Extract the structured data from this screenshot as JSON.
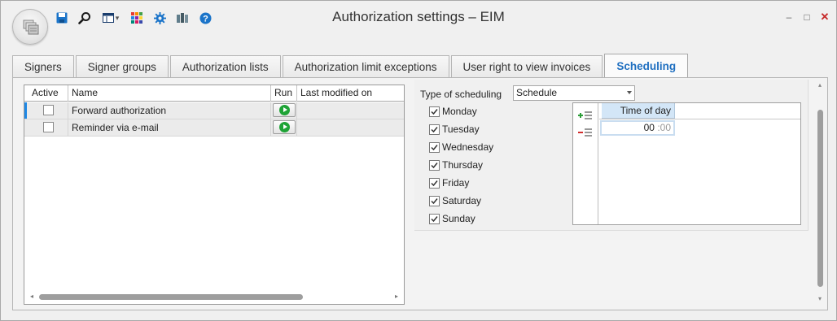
{
  "window": {
    "title": "Authorization settings – EIM",
    "controls": {
      "minimize": "–",
      "maximize": "□",
      "close": "✕"
    }
  },
  "toolbar": {
    "icons": [
      "save-icon",
      "search-icon",
      "layout-icon",
      "color-grid-icon",
      "gear-icon",
      "books-icon",
      "help-icon"
    ],
    "layout_dropdown": "▾"
  },
  "tabs": [
    {
      "label": "Signers",
      "active": false
    },
    {
      "label": "Signer groups",
      "active": false
    },
    {
      "label": "Authorization lists",
      "active": false
    },
    {
      "label": "Authorization limit exceptions",
      "active": false
    },
    {
      "label": "User right to view invoices",
      "active": false
    },
    {
      "label": "Scheduling",
      "active": true
    }
  ],
  "grid": {
    "columns": [
      "Active",
      "Name",
      "Run",
      "Last modified on"
    ],
    "rows": [
      {
        "active": false,
        "name": "Forward authorization",
        "last_modified": "",
        "selected": true
      },
      {
        "active": false,
        "name": "Reminder via e-mail",
        "last_modified": "",
        "selected": false
      }
    ],
    "scroll_left": "◂",
    "scroll_right": "▸"
  },
  "scheduling": {
    "type_label": "Type of scheduling",
    "type_value": "Schedule",
    "days": [
      {
        "label": "Monday",
        "checked": true
      },
      {
        "label": "Tuesday",
        "checked": true
      },
      {
        "label": "Wednesday",
        "checked": true
      },
      {
        "label": "Thursday",
        "checked": true
      },
      {
        "label": "Friday",
        "checked": true
      },
      {
        "label": "Saturday",
        "checked": true
      },
      {
        "label": "Sunday",
        "checked": true
      }
    ],
    "time_grid": {
      "header": "Time of day",
      "entry_hours": "00",
      "entry_minutes": ":00"
    }
  },
  "vscroll": {
    "up": "▴",
    "down": "▾"
  },
  "colors": {
    "accent": "#1f6fc0",
    "selection_indicator": "#1e88e5",
    "run_green": "#1fa336",
    "header_highlight": "#d3e6f7"
  }
}
